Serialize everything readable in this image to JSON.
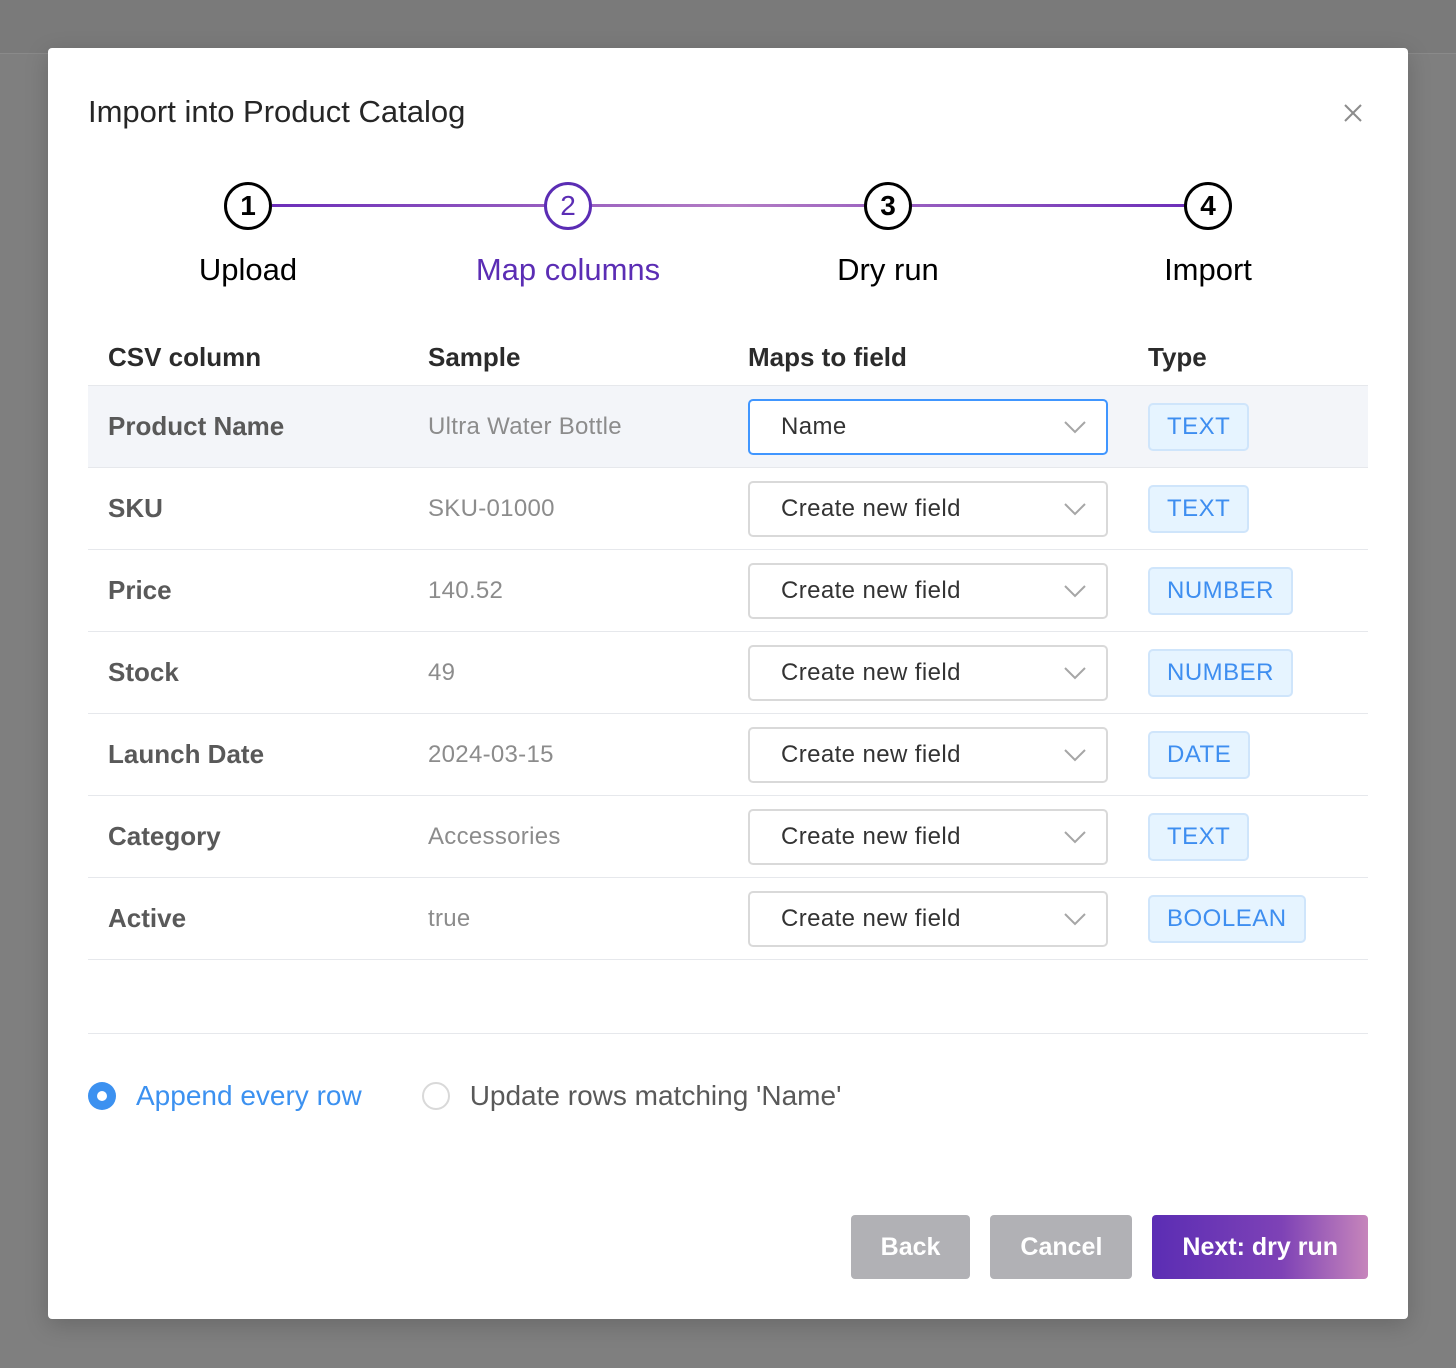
{
  "modal": {
    "title": "Import into Product Catalog",
    "close_icon": "close-icon"
  },
  "stepper": {
    "active_step": 2,
    "steps": [
      {
        "number": "1",
        "label": "Upload"
      },
      {
        "number": "2",
        "label": "Map columns"
      },
      {
        "number": "3",
        "label": "Dry run"
      },
      {
        "number": "4",
        "label": "Import"
      }
    ]
  },
  "table": {
    "headers": [
      "CSV column",
      "Sample",
      "Maps to field",
      "Type"
    ],
    "rows": [
      {
        "column": "Product Name",
        "sample": "Ultra Water Bottle",
        "field": "Name",
        "type": "TEXT"
      },
      {
        "column": "SKU",
        "sample": "SKU-01000",
        "field": "Create new field",
        "type": "TEXT"
      },
      {
        "column": "Price",
        "sample": "140.52",
        "field": "Create new field",
        "type": "NUMBER"
      },
      {
        "column": "Stock",
        "sample": "49",
        "field": "Create new field",
        "type": "NUMBER"
      },
      {
        "column": "Launch Date",
        "sample": "2024-03-15",
        "field": "Create new field",
        "type": "DATE"
      },
      {
        "column": "Category",
        "sample": "Accessories",
        "field": "Create new field",
        "type": "TEXT"
      },
      {
        "column": "Active",
        "sample": "true",
        "field": "Create new field",
        "type": "BOOLEAN"
      }
    ]
  },
  "mode": {
    "options": [
      {
        "label": "Append every row",
        "checked": true
      },
      {
        "label": "Update rows matching 'Name'",
        "checked": false
      }
    ]
  },
  "footer": {
    "back_label": "Back",
    "cancel_label": "Cancel",
    "next_label": "Next: dry run"
  },
  "colors": {
    "accent": "#5b2db4",
    "link_blue": "#3c91f0",
    "tag_bg": "#e6f4ff",
    "backdrop": "#7f7f7f"
  }
}
